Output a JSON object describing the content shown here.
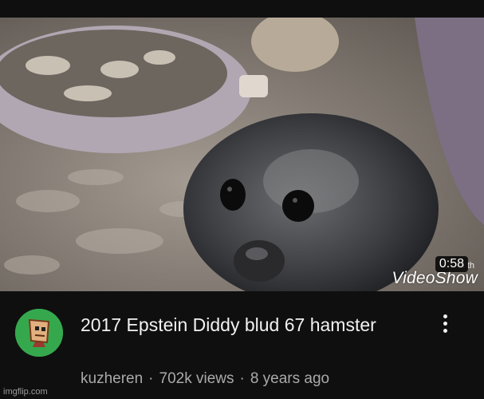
{
  "video": {
    "duration": "0:58",
    "watermark": "VideoShow",
    "watermark_top": "M       th",
    "title": "2017 Epstein Diddy blud 67 hamster",
    "channel": "kuzheren",
    "views": "702k views",
    "age": "8 years ago"
  },
  "separator": "·",
  "icons": {
    "more": "vertical-ellipsis-icon",
    "avatar": "channel-avatar-icon"
  },
  "footer": {
    "credit": "imgflip.com"
  },
  "colors": {
    "background": "#0f0f0f",
    "title_text": "#f1f1f1",
    "secondary_text": "#aaaaaa",
    "avatar_bg": "#35a84d"
  }
}
